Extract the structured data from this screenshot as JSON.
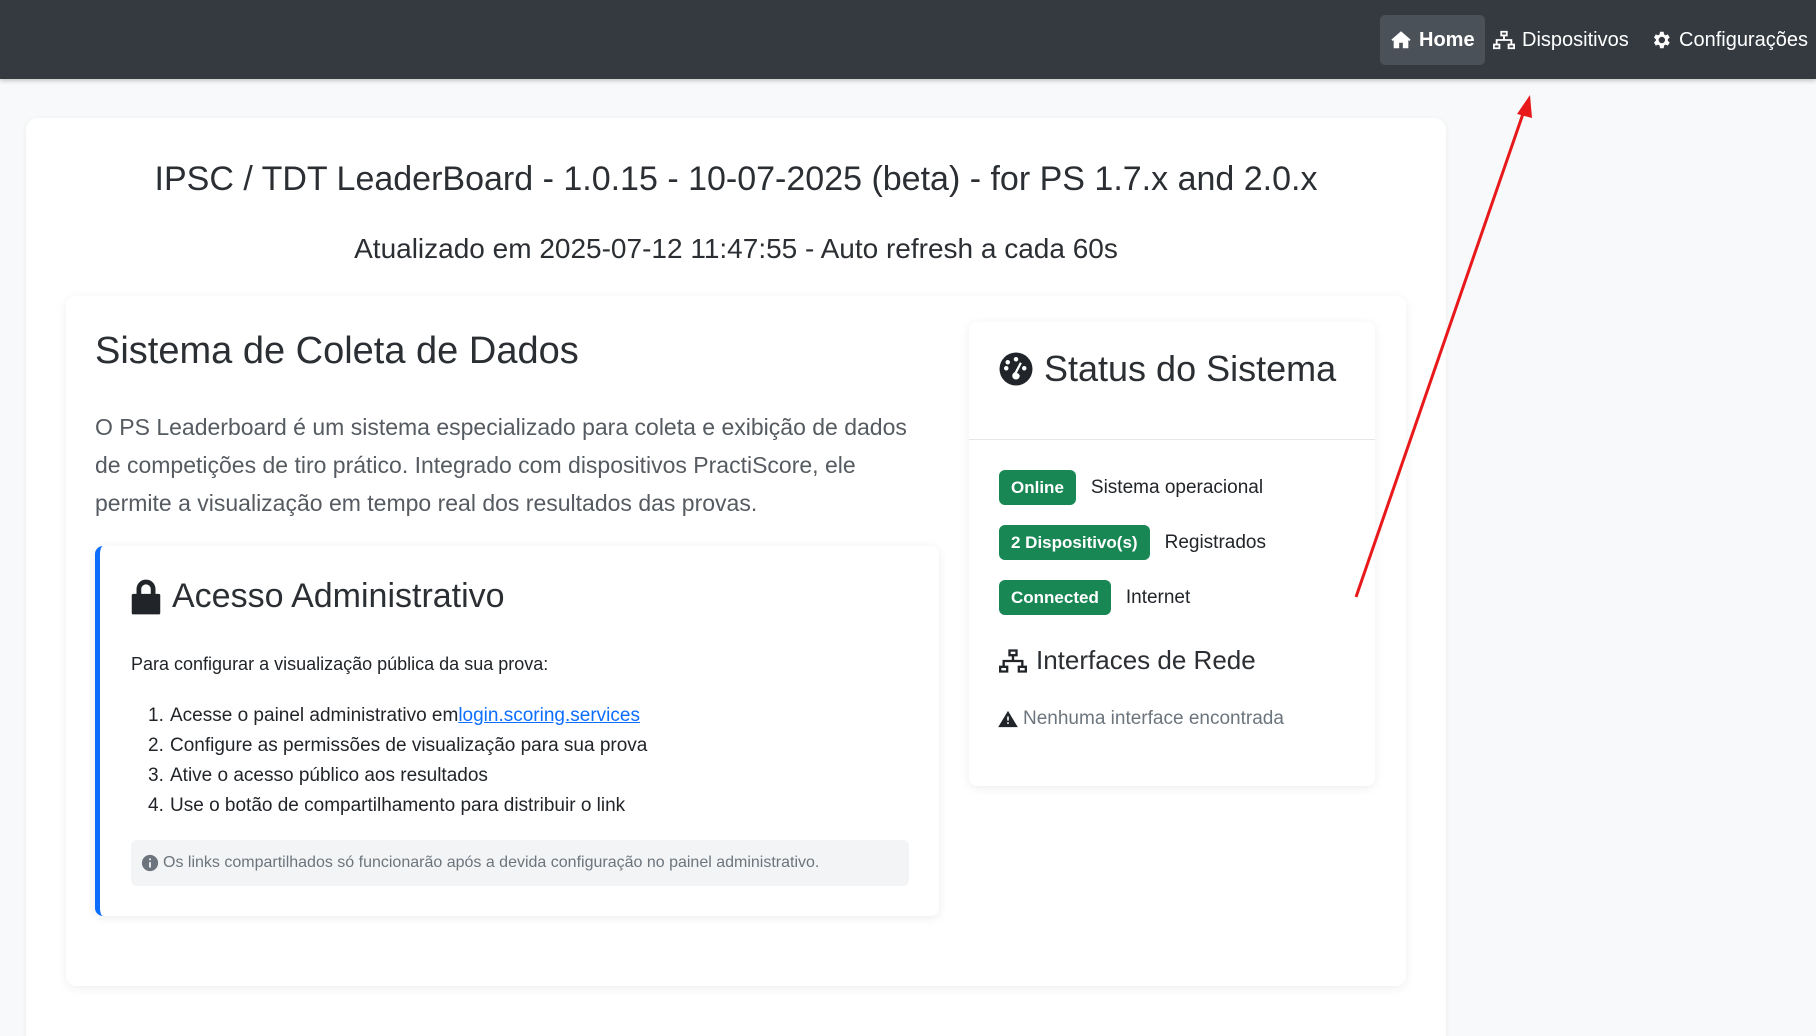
{
  "nav": {
    "items": [
      {
        "label": "Home",
        "icon": "home-icon"
      },
      {
        "label": "Dispositivos",
        "icon": "network-icon"
      },
      {
        "label": "Configurações",
        "icon": "gear-icon"
      }
    ]
  },
  "header": {
    "title": "IPSC / TDT LeaderBoard - 1.0.15 - 10-07-2025 (beta) - for PS 1.7.x and 2.0.x",
    "subtitle": "Atualizado em 2025-07-12 11:47:55 - Auto refresh a cada 60s"
  },
  "main": {
    "heading": "Sistema de Coleta de Dados",
    "lead": "O PS Leaderboard é um sistema especializado para coleta e exibição de dados de competições de tiro prático. Integrado com dispositivos PractiScore, ele permite a visualização em tempo real dos resultados das provas."
  },
  "admin": {
    "title": "Acesso Administrativo",
    "intro": "Para configurar a visualização pública da sua prova:",
    "steps": [
      {
        "num": "1.",
        "text": "Acesse o painel administrativo em ",
        "link": "login.scoring.services"
      },
      {
        "num": "2.",
        "text": "Configure as permissões de visualização para sua prova"
      },
      {
        "num": "3.",
        "text": "Ative o acesso público aos resultados"
      },
      {
        "num": "4.",
        "text": "Use o botão de compartilhamento para distribuir o link"
      }
    ],
    "note": "Os links compartilhados só funcionarão após a devida configuração no painel administrativo."
  },
  "status": {
    "title": "Status do Sistema",
    "rows": [
      {
        "badge": "Online",
        "label": "Sistema operacional"
      },
      {
        "badge": "2 Dispositivo(s)",
        "label": "Registrados"
      },
      {
        "badge": "Connected",
        "label": "Internet"
      }
    ],
    "network_title": "Interfaces de Rede",
    "network_empty": "Nenhuma interface encontrada"
  },
  "colors": {
    "navbar": "#343a40",
    "badge_success": "#198754",
    "accent": "#0d6efd",
    "annotation_arrow": "#e8191b"
  }
}
